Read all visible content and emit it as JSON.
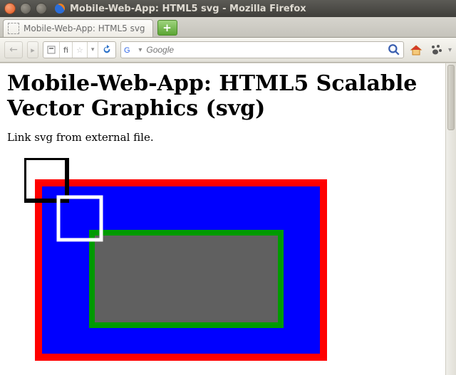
{
  "window": {
    "title": "Mobile-Web-App: HTML5 svg - Mozilla Firefox"
  },
  "tabs": {
    "active_label": "Mobile-Web-App: HTML5 svg"
  },
  "url": {
    "path_short": "fi"
  },
  "search": {
    "placeholder": "Google"
  },
  "page": {
    "heading": "Mobile-Web-App: HTML5 Scalable Vector Graphics (svg)",
    "paragraph": "Link svg from external file."
  },
  "svg": {
    "outer": {
      "fill": "#0000ff",
      "stroke": "#ff0000"
    },
    "inner": {
      "fill": "#606060",
      "stroke": "#009a00"
    },
    "box_black_stroke": "#000000",
    "box_white_stroke": "#ffffff"
  }
}
